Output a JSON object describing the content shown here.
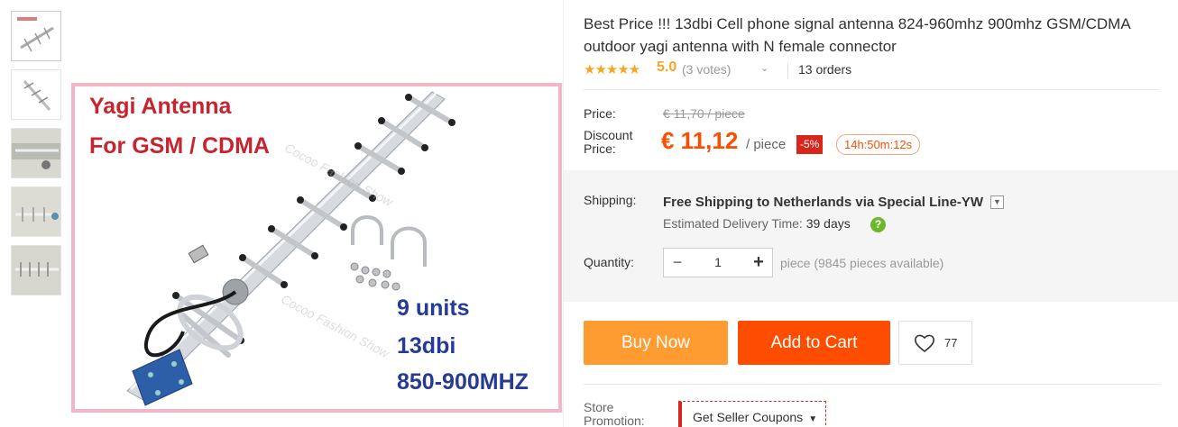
{
  "product": {
    "title": "Best Price !!! 13dbi Cell phone signal antenna 824-960mhz 900mhz GSM/CDMA outdoor yagi antenna with N female connector",
    "stars": "★★★★★",
    "score": "5.0",
    "votes": "(3 votes)",
    "orders": "13 orders"
  },
  "image": {
    "title_line1": "Yagi Antenna",
    "title_line2": "For GSM / CDMA",
    "spec_line1": "9 units",
    "spec_line2": "13dbi",
    "spec_line3": "850-900MHZ",
    "watermark": "Cocoo Fashion Show"
  },
  "price": {
    "label": "Price:",
    "original": "€ 11,70 / piece",
    "discount_label": "Discount Price:",
    "current": "€ 11,12",
    "unit": "/ piece",
    "discount_badge": "-5%",
    "countdown": "14h:50m:12s"
  },
  "shipping": {
    "label": "Shipping:",
    "value": "Free Shipping to Netherlands via Special Line-YW",
    "estimate_label": "Estimated Delivery Time:",
    "estimate_days": "39 days",
    "help_icon": "?"
  },
  "quantity": {
    "label": "Quantity:",
    "minus": "−",
    "value": "1",
    "plus": "+",
    "available": "piece (9845 pieces available)"
  },
  "actions": {
    "buy_now": "Buy Now",
    "add_to_cart": "Add to Cart",
    "wishlist_count": "77"
  },
  "store": {
    "label": "Store Promotion:",
    "coupon_button": "Get Seller Coupons"
  },
  "colors": {
    "accent_orange": "#ff4d00",
    "buy_orange": "#ff9c31",
    "star": "#f6a623",
    "discount_red": "#d9261c"
  }
}
